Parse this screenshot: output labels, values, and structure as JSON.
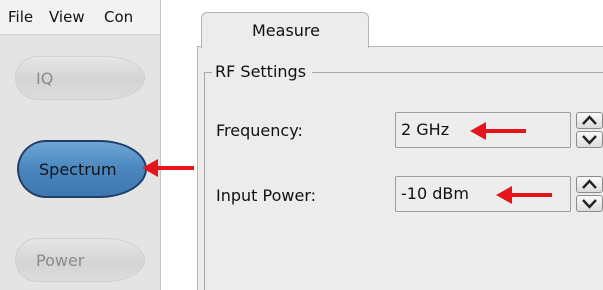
{
  "menubar": {
    "items": [
      "File",
      "View",
      "Con"
    ]
  },
  "sidebar": {
    "buttons": [
      {
        "label": "IQ",
        "active": false
      },
      {
        "label": "Spectrum",
        "active": true
      },
      {
        "label": "Power",
        "active": false
      }
    ]
  },
  "panel": {
    "tab_label": "Measure",
    "group_title": "RF Settings",
    "fields": [
      {
        "label": "Frequency:",
        "value": "2 GHz"
      },
      {
        "label": "Input Power:",
        "value": "-10 dBm"
      }
    ]
  },
  "colors": {
    "annotation_arrow": "#e8141b",
    "active_button": "#4a86bf",
    "active_border": "#1f3f66"
  },
  "icons": [
    "spin-up-arrow-icon",
    "spin-down-arrow-icon",
    "annotation-arrow-icon"
  ]
}
